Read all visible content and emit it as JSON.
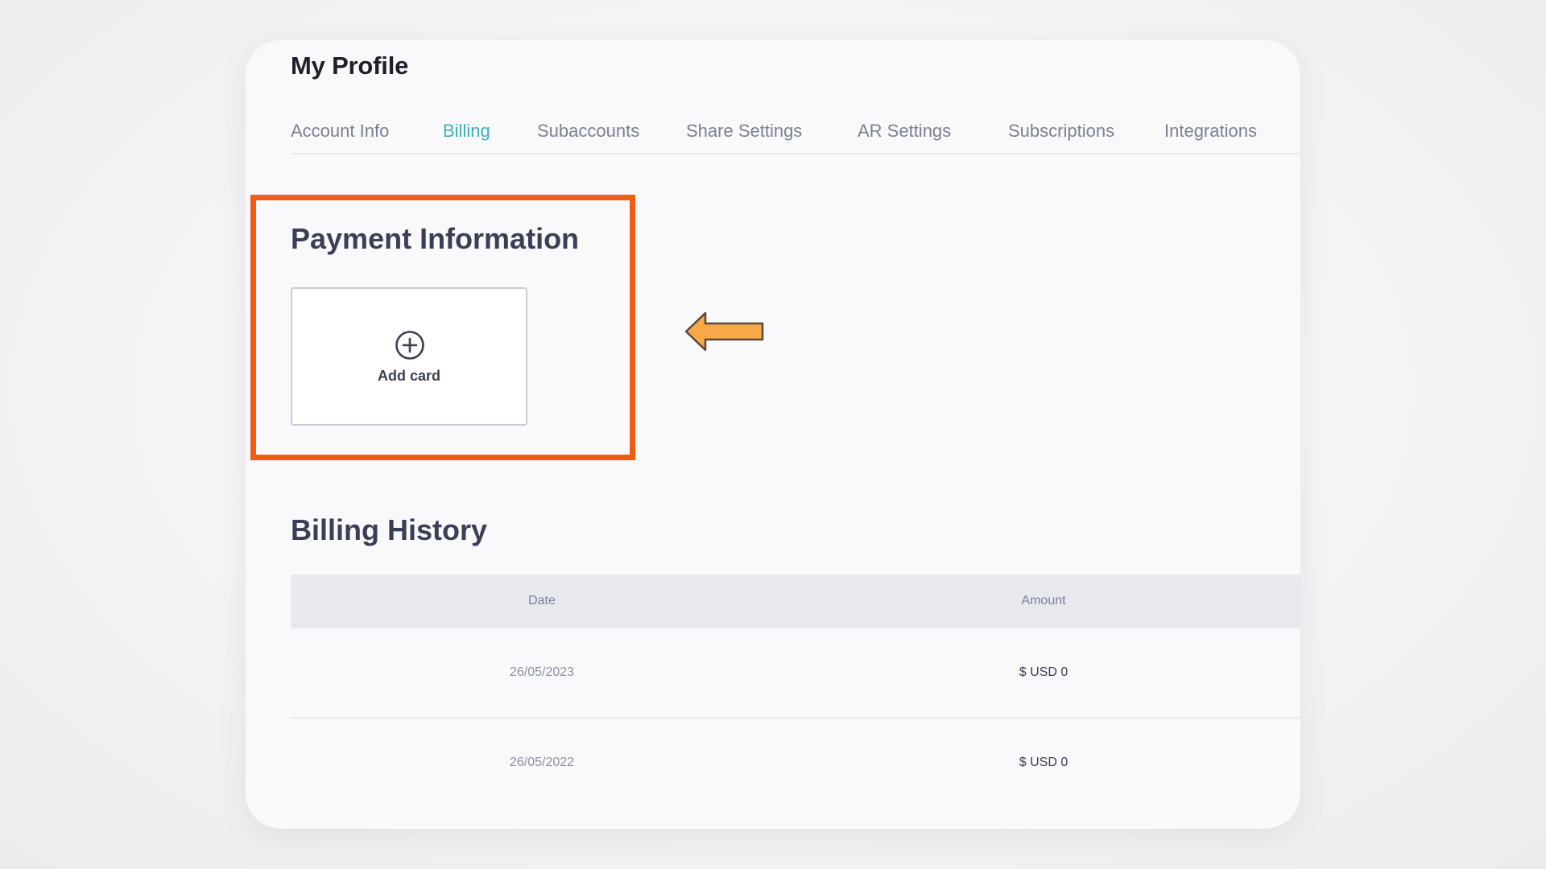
{
  "page": {
    "title": "My Profile"
  },
  "tabs": [
    {
      "label": "Account Info",
      "active": false
    },
    {
      "label": "Billing",
      "active": true
    },
    {
      "label": "Subaccounts",
      "active": false
    },
    {
      "label": "Share Settings",
      "active": false
    },
    {
      "label": "AR Settings",
      "active": false
    },
    {
      "label": "Subscriptions",
      "active": false
    },
    {
      "label": "Integrations",
      "active": false
    }
  ],
  "payment": {
    "title": "Payment Information",
    "add_card_label": "Add card",
    "add_card_icon": "plus-circle-icon"
  },
  "billing_history": {
    "title": "Billing History",
    "columns": [
      "Date",
      "Amount"
    ],
    "rows": [
      {
        "date": "26/05/2023",
        "amount": "$ USD 0"
      },
      {
        "date": "26/05/2022",
        "amount": "$ USD 0"
      }
    ]
  },
  "annotations": {
    "highlight_color": "#f25c14",
    "arrow_color": "#f7a94a",
    "arrow_icon": "left-arrow-icon"
  },
  "colors": {
    "accent": "#3bb0b8",
    "text_dark": "#1d1f2a",
    "text_muted": "#7b8094",
    "table_header_bg": "#e7e9ee"
  }
}
